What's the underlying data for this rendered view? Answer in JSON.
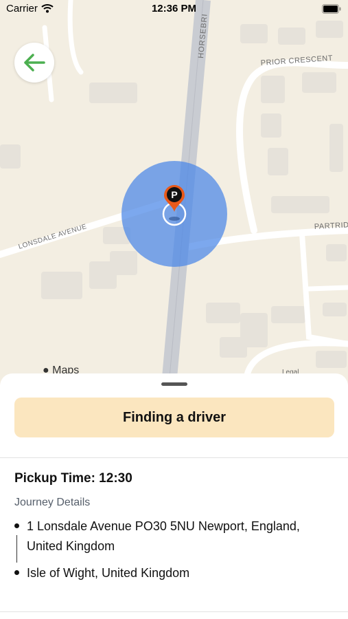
{
  "status_bar": {
    "carrier": "Carrier",
    "time": "12:36 PM"
  },
  "map": {
    "streets": {
      "horsebridge": "HORSEBRI",
      "prior_crescent": "PRIOR CRESCENT",
      "lonsdale_avenue": "LONSDALE AVENUE",
      "partridge": "PARTRID"
    },
    "pin_label": "P",
    "attribution": "Maps",
    "legal": "Legal"
  },
  "sheet": {
    "status": "Finding a driver",
    "pickup_time": "Pickup Time: 12:30",
    "journey_heading": "Journey Details",
    "stops": [
      "1 Lonsdale Avenue PO30 5NU Newport, England, United Kingdom",
      "Isle of Wight, United Kingdom"
    ]
  },
  "colors": {
    "accent_green": "#4caf50",
    "pin_orange": "#e8591a",
    "banner_bg": "#fbe6bf",
    "search_radius": "#4a86e8"
  }
}
